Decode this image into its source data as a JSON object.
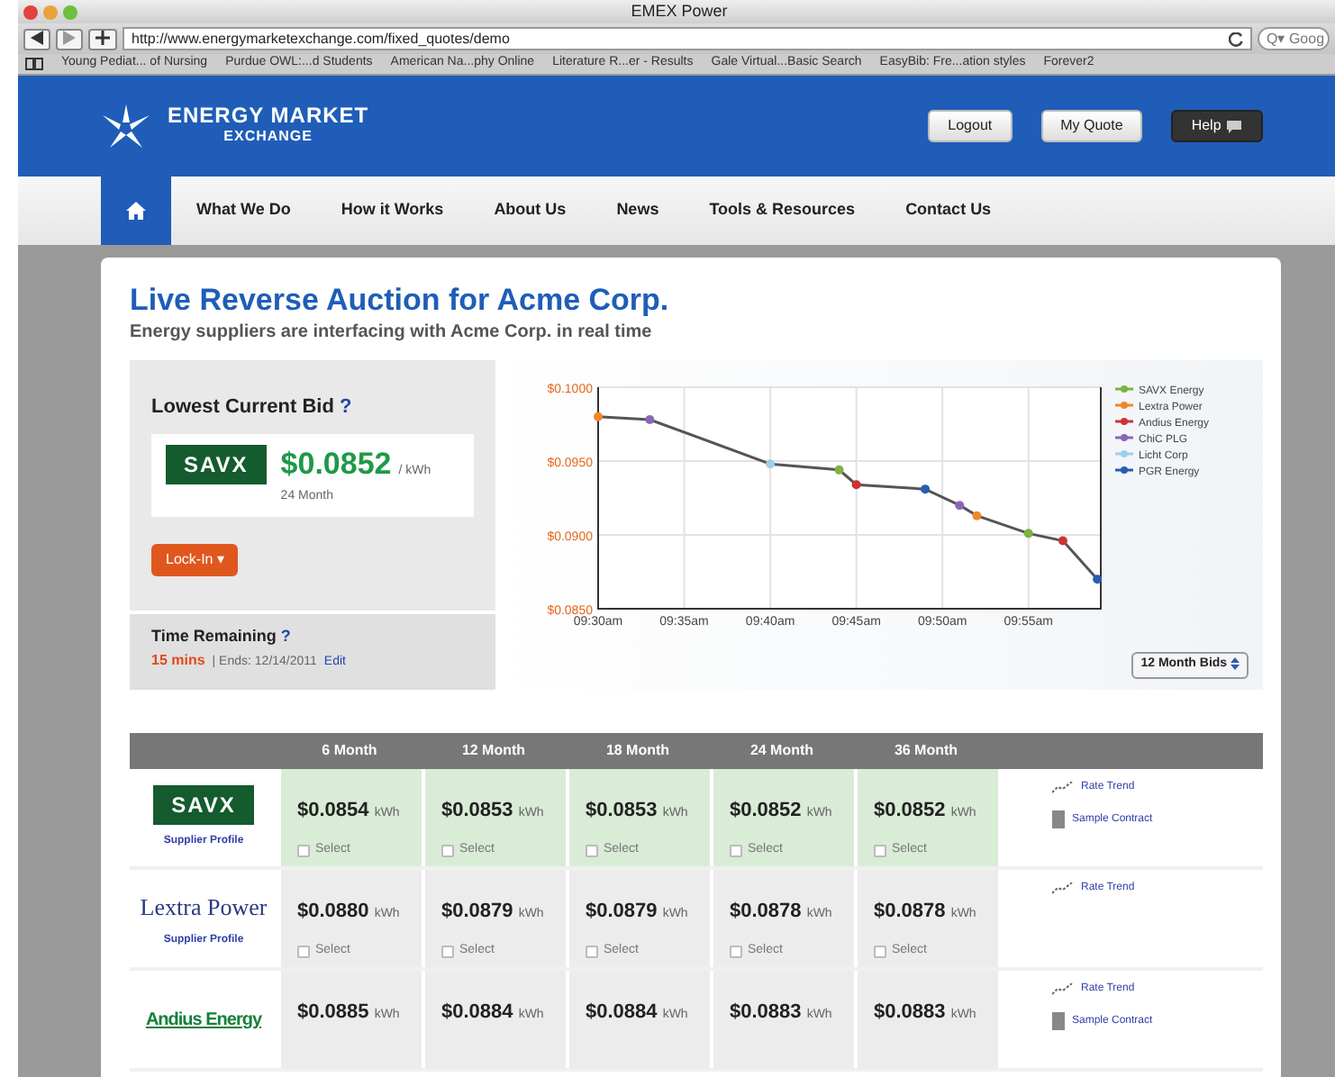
{
  "browser": {
    "title": "EMEX Power",
    "url": "http://www.energymarketexchange.com/fixed_quotes/demo",
    "search_placeholder": "Q▾ Goog",
    "bookmarks": [
      "Young Pediat... of Nursing",
      "Purdue OWL:...d Students",
      "American Na...phy Online",
      "Literature R...er - Results",
      "Gale Virtual...Basic Search",
      "EasyBib: Fre...ation styles",
      "Forever2"
    ]
  },
  "header": {
    "logo_line1": "ENERGY MARKET",
    "logo_line2": "EXCHANGE",
    "buttons": [
      {
        "label": "Logout",
        "kind": "light"
      },
      {
        "label": "My Quote",
        "kind": "light"
      },
      {
        "label": "Help",
        "kind": "dark"
      }
    ]
  },
  "nav": [
    {
      "kind": "home",
      "selected": true
    },
    {
      "label": "What We Do",
      "selected": false
    },
    {
      "label": "How it Works",
      "selected": false
    },
    {
      "label": "About Us",
      "selected": false
    },
    {
      "label": "News",
      "selected": false
    },
    {
      "label": "Tools & Resources",
      "selected": false
    },
    {
      "label": "Contact Us",
      "selected": false
    }
  ],
  "page": {
    "title": "Live Reverse Auction for Acme Corp.",
    "subtitle": "Energy suppliers are interfacing with Acme Corp. in real time"
  },
  "lowest_bid": {
    "heading": "Lowest Current Bid",
    "help": "?",
    "supplier": "SAVX",
    "price": "$0.0852",
    "unit": "/ kWh",
    "term": "24 Month",
    "button": "Lock-In",
    "caret": "▾"
  },
  "time_remaining": {
    "heading": "Time Remaining",
    "help": "?",
    "value": "15 mins",
    "ends": "| Ends: 12/14/2011",
    "edit": "Edit"
  },
  "chart": {
    "chart_data": {
      "type": "line",
      "grid": true,
      "legend": "right",
      "categories": [
        "09:30am",
        null,
        null,
        null,
        null,
        "09:35am",
        null,
        null,
        null,
        null,
        "09:40am",
        null,
        null,
        null,
        null,
        "09:45am",
        null,
        null,
        null,
        null,
        "09:50am",
        null,
        null,
        null,
        null,
        "09:55am",
        null,
        null,
        null,
        null
      ],
      "ylim": [
        0.085,
        0.1
      ],
      "yticks": [
        {
          "value": 0.1,
          "label": "$0.1000"
        },
        {
          "value": 0.095,
          "label": "$0.0950"
        },
        {
          "value": 0.09,
          "label": "$0.0900"
        },
        {
          "value": 0.085,
          "label": "$0.0850"
        }
      ],
      "series": [
        {
          "type": "line",
          "color": "#555555",
          "values": [
            0.098,
            null,
            null,
            0.0978,
            null,
            null,
            null,
            null,
            null,
            null,
            0.0948,
            null,
            null,
            null,
            0.0944,
            0.0934,
            null,
            null,
            null,
            0.0931,
            null,
            0.092,
            0.0913,
            null,
            null,
            0.0901,
            null,
            0.0896,
            null,
            0.087
          ]
        },
        {
          "name": "SAVX Energy",
          "type": "scatter",
          "marker": "circle",
          "color": "#7cb342",
          "values": [
            null,
            null,
            null,
            null,
            null,
            null,
            null,
            null,
            null,
            null,
            null,
            null,
            null,
            null,
            0.0944,
            null,
            null,
            null,
            null,
            null,
            null,
            null,
            null,
            null,
            null,
            0.0901,
            null,
            null,
            null,
            null
          ]
        },
        {
          "name": "Lextra Power",
          "type": "scatter",
          "marker": "circle",
          "color": "#f0882a",
          "values": [
            0.098,
            null,
            null,
            null,
            null,
            null,
            null,
            null,
            null,
            null,
            null,
            null,
            null,
            null,
            null,
            null,
            null,
            null,
            null,
            null,
            null,
            null,
            0.0913,
            null,
            null,
            null,
            null,
            null,
            null,
            null
          ]
        },
        {
          "name": "Andius Energy",
          "type": "scatter",
          "marker": "circle",
          "color": "#cc3333",
          "values": [
            null,
            null,
            null,
            null,
            null,
            null,
            null,
            null,
            null,
            null,
            null,
            null,
            null,
            null,
            null,
            0.0934,
            null,
            null,
            null,
            null,
            null,
            null,
            null,
            null,
            null,
            null,
            null,
            0.0896,
            null,
            null
          ]
        },
        {
          "name": "ChiC PLG",
          "type": "scatter",
          "marker": "circle",
          "color": "#8a66b8",
          "values": [
            null,
            null,
            null,
            0.0978,
            null,
            null,
            null,
            null,
            null,
            null,
            null,
            null,
            null,
            null,
            null,
            null,
            null,
            null,
            null,
            null,
            null,
            0.092,
            null,
            null,
            null,
            null,
            null,
            null,
            null,
            null
          ]
        },
        {
          "name": "Licht Corp",
          "type": "scatter",
          "marker": "circle",
          "color": "#9fcdee",
          "values": [
            null,
            null,
            null,
            null,
            null,
            null,
            null,
            null,
            null,
            null,
            0.0948,
            null,
            null,
            null,
            null,
            null,
            null,
            null,
            null,
            null,
            null,
            null,
            null,
            null,
            null,
            null,
            null,
            null,
            null,
            null
          ]
        },
        {
          "name": "PGR Energy",
          "type": "scatter",
          "marker": "circle",
          "color": "#2a5db0",
          "values": [
            null,
            null,
            null,
            null,
            null,
            null,
            null,
            null,
            null,
            null,
            null,
            null,
            null,
            null,
            null,
            null,
            null,
            null,
            null,
            0.0931,
            null,
            null,
            null,
            null,
            null,
            null,
            null,
            null,
            null,
            0.087
          ]
        }
      ]
    },
    "select": "12 Month Bids"
  },
  "table": {
    "columns": [
      "6 Month",
      "12 Month",
      "18 Month",
      "24 Month",
      "36 Month"
    ],
    "rows": [
      {
        "supplier": "SAVX",
        "kind": "badge",
        "profile": "Supplier Profile",
        "highlighted": true,
        "quotes": [
          {
            "price": "$0.0854",
            "unit": "kWh",
            "select": "Select",
            "checked": false
          },
          {
            "price": "$0.0853",
            "unit": "kWh",
            "select": "Select",
            "checked": false
          },
          {
            "price": "$0.0853",
            "unit": "kWh",
            "select": "Select",
            "checked": false
          },
          {
            "price": "$0.0852",
            "unit": "kWh",
            "select": "Select",
            "checked": false
          },
          {
            "price": "$0.0852",
            "unit": "kWh",
            "select": "Select",
            "checked": false
          }
        ],
        "actions": [
          {
            "kind": "trend",
            "label": "Rate Trend"
          },
          {
            "kind": "contract",
            "label": "Sample Contract"
          }
        ]
      },
      {
        "supplier": "Lextra Power",
        "kind": "serif",
        "profile": "Supplier Profile",
        "highlighted": false,
        "quotes": [
          {
            "price": "$0.0880",
            "unit": "kWh",
            "select": "Select",
            "checked": false
          },
          {
            "price": "$0.0879",
            "unit": "kWh",
            "select": "Select",
            "checked": false
          },
          {
            "price": "$0.0879",
            "unit": "kWh",
            "select": "Select",
            "checked": false
          },
          {
            "price": "$0.0878",
            "unit": "kWh",
            "select": "Select",
            "checked": false
          },
          {
            "price": "$0.0878",
            "unit": "kWh",
            "select": "Select",
            "checked": false
          }
        ],
        "actions": [
          {
            "kind": "trend",
            "label": "Rate Trend"
          }
        ]
      },
      {
        "supplier": "Andius Energy",
        "kind": "underlined",
        "highlighted": false,
        "quotes": [
          {
            "price": "$0.0885",
            "unit": "kWh"
          },
          {
            "price": "$0.0884",
            "unit": "kWh"
          },
          {
            "price": "$0.0884",
            "unit": "kWh"
          },
          {
            "price": "$0.0883",
            "unit": "kWh"
          },
          {
            "price": "$0.0883",
            "unit": "kWh"
          }
        ],
        "actions": [
          {
            "kind": "trend",
            "label": "Rate Trend"
          },
          {
            "kind": "contract",
            "label": "Sample Contract"
          }
        ]
      }
    ]
  }
}
